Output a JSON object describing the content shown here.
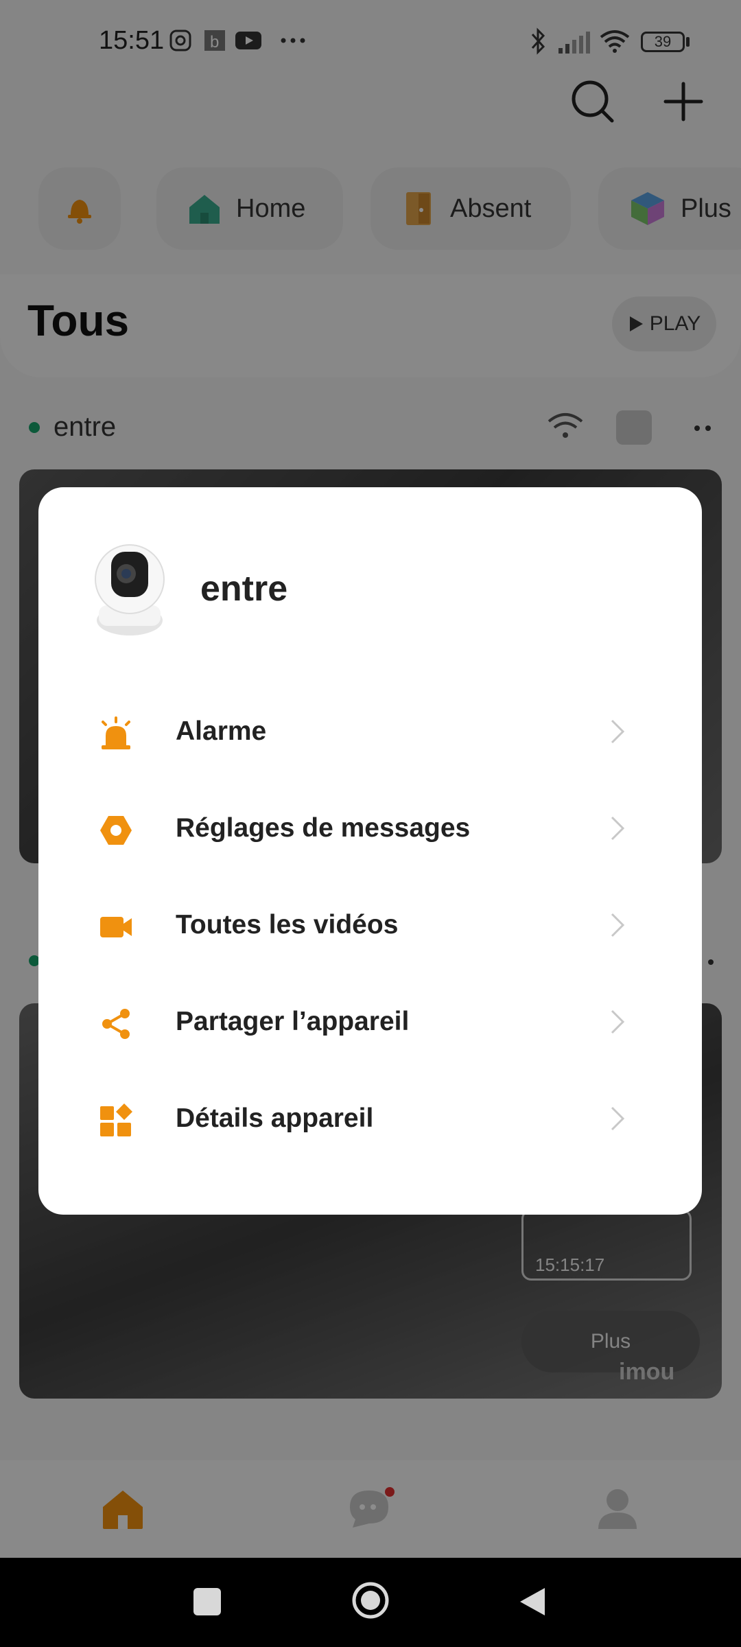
{
  "status_bar": {
    "time": "15:51",
    "icons": [
      "instagram-icon",
      "b-app-icon",
      "youtube-icon",
      "more-dots-icon"
    ],
    "right_icons": [
      "bluetooth-icon",
      "signal-icon",
      "wifi-icon",
      "battery-icon"
    ],
    "battery": "39"
  },
  "header": {
    "search_icon": "search-icon",
    "add_icon": "plus-icon"
  },
  "scenes": [
    {
      "label": "",
      "icon": "bell-icon"
    },
    {
      "label": "Home",
      "icon": "home-icon"
    },
    {
      "label": "Absent",
      "icon": "door-icon"
    },
    {
      "label": "Plus",
      "icon": "cube-icon"
    }
  ],
  "section": {
    "title": "Tous",
    "play_label": "PLAY"
  },
  "device": {
    "name": "entre",
    "timestamp": "15:15:17",
    "more_label": "Plus",
    "brand": "imou"
  },
  "dialog": {
    "title": "entre",
    "items": [
      {
        "label": "Alarme",
        "icon": "alarm-icon"
      },
      {
        "label": "Réglages de messages",
        "icon": "message-settings-icon"
      },
      {
        "label": "Toutes les vidéos",
        "icon": "video-icon"
      },
      {
        "label": "Partager l’appareil",
        "icon": "share-icon"
      },
      {
        "label": "Détails appareil",
        "icon": "details-icon"
      }
    ]
  },
  "bottom_nav": {
    "tabs": [
      "home-tab",
      "messages-tab",
      "profile-tab"
    ],
    "accent_color": "#f0910f"
  }
}
